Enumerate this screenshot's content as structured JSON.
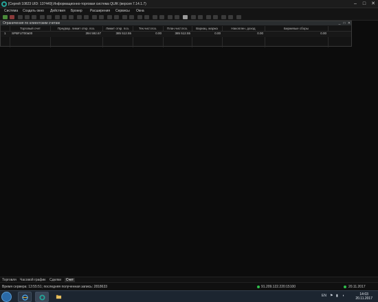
{
  "window": {
    "title": "[Сергей 10823 UID: 137449] Информационно-торговая система QUIK (версия 7.14.1.7)"
  },
  "menu": [
    "Система",
    "Создать окно",
    "Действия",
    "Брокер",
    "Расширения",
    "Сервисы",
    "Окна"
  ],
  "subwindow": {
    "title": "Ограничения по клиентским счетам"
  },
  "table": {
    "columns": [
      "Торговый счет",
      "Предвар. лимит откр. поз.",
      "Лимит откр. поз.",
      "Тек.чист.поз.",
      "План.чист.поз.",
      "Вариац. маржа",
      "Накоплен. доход",
      "Биржевые сборы"
    ],
    "rows": [
      {
        "index": "1",
        "account": "SPBFUT00a00",
        "prelim_limit": "394 592.67",
        "limit": "385 512.55",
        "cur_net": "0.00",
        "plan_net": "385 512.55",
        "var_margin": "0.00",
        "accum_income": "0.00",
        "fees": "0.00"
      }
    ]
  },
  "tabs": [
    "Торговля",
    "Часовой график",
    "Сделки",
    "Счет"
  ],
  "status": {
    "server_time": "Время сервера: 13:55:51; последняя полученная запись: 2818633",
    "connection": "91.209.122.220:15100",
    "date": "20.11.2017"
  },
  "taskbar": {
    "lang": "EN",
    "time": "14:03",
    "date": "20.11.2017"
  },
  "colors": {
    "accent": "#25a59a",
    "status_ok": "#2fbf4a"
  },
  "icons": [
    "quik-app-icon",
    "minimize-icon",
    "maximize-icon",
    "close-icon",
    "start-icon",
    "ie-icon",
    "folder-icon",
    "quik-task-icon"
  ]
}
